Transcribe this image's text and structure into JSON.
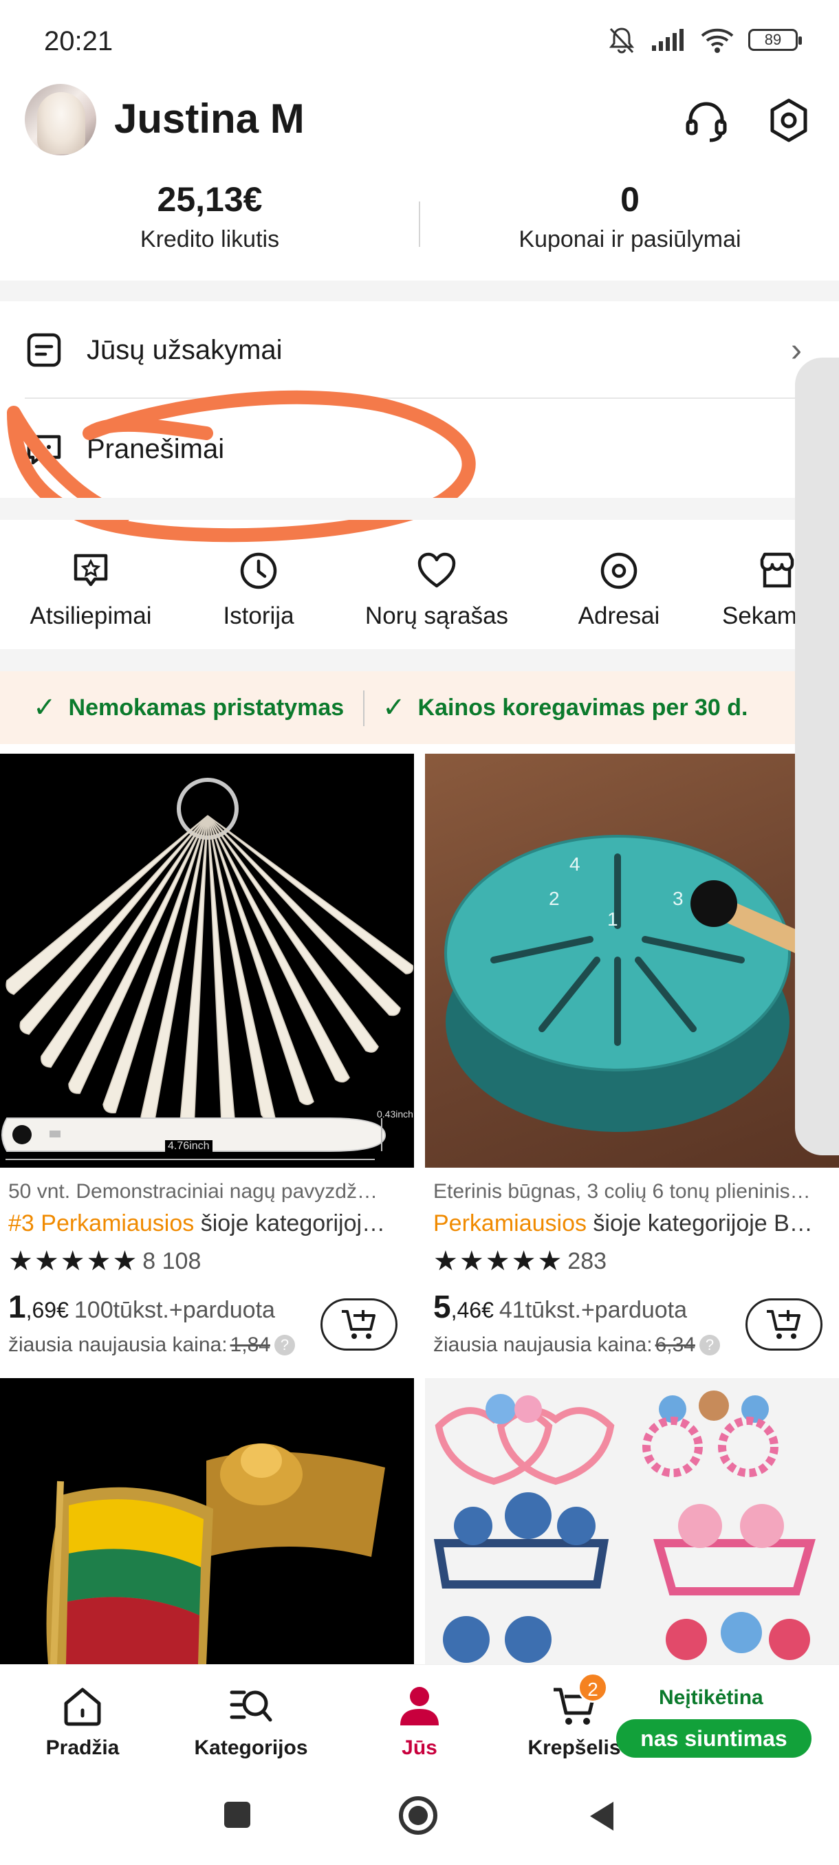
{
  "status_bar": {
    "time": "20:21",
    "battery": "89"
  },
  "profile": {
    "name": "Justina M"
  },
  "balances": [
    {
      "value": "25,13€",
      "label": "Kredito likutis"
    },
    {
      "value": "0",
      "label": "Kuponai ir pasiūlymai"
    }
  ],
  "menu": {
    "orders": "Jūsų užsakymai",
    "messages": "Pranešimai"
  },
  "shortcuts": [
    {
      "label": "Atsiliepimai",
      "icon": "review-icon"
    },
    {
      "label": "Istorija",
      "icon": "clock-icon"
    },
    {
      "label": "Norų sąrašas",
      "icon": "heart-icon"
    },
    {
      "label": "Adresai",
      "icon": "location-icon"
    },
    {
      "label": "Sekam",
      "icon": "store-icon"
    }
  ],
  "benefits": [
    "Nemokamas pristatymas",
    "Kainos koregavimas per 30 d."
  ],
  "products": [
    {
      "title": "50 vnt. Demonstraciniai nagų pavyzdž…",
      "rank_hot": "#3 Perkamiausios",
      "rank_rest": " šioje kategorijoj…",
      "rating_count": "8 108",
      "price_int": "1",
      "price_dec": ",69€",
      "sold": "100tūkst.+parduota",
      "low_label": "žiausia naujausia kaina:",
      "low_price": "1,84",
      "img_dim_small": "0.43inch",
      "img_dim_long": "4.76inch"
    },
    {
      "title": "Eterinis būgnas, 3 colių 6 tonų plieninis…",
      "rank_hot": "Perkamiausios",
      "rank_rest": " šioje kategorijoje B…",
      "rating_count": "283",
      "price_int": "5",
      "price_dec": ",46€",
      "sold": "41tūkst.+parduota",
      "low_label": "žiausia naujausia kaina:",
      "low_price": "6,34"
    }
  ],
  "tabs": [
    {
      "label": "Pradžia",
      "icon": "home-icon"
    },
    {
      "label": "Kategorijos",
      "icon": "category-search-icon"
    },
    {
      "label": "Jūs",
      "icon": "user-icon"
    },
    {
      "label": "Krepšelis",
      "icon": "cart-icon"
    }
  ],
  "cart_badge": "2",
  "promo": {
    "top": "Neįtikėtina",
    "pill": "nas siuntimas"
  },
  "colors": {
    "accent": "#c8003d",
    "green": "#0b7a2c",
    "orange": "#f08a00",
    "circle_annotation": "#f47a4a"
  }
}
